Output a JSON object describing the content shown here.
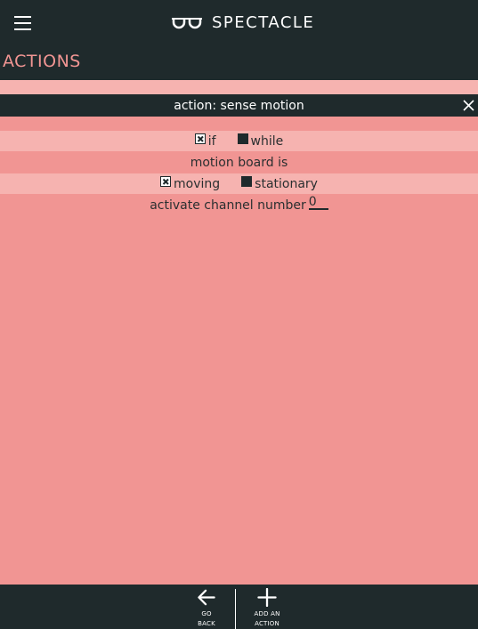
{
  "header": {
    "brand": "SPECTACLE",
    "menu_icon": "hamburger-icon",
    "logo_icon": "glasses-icon"
  },
  "section": {
    "title": "ACTIONS"
  },
  "action": {
    "title": "action: sense motion",
    "close_icon": "close-icon",
    "mode": {
      "if_label": "if",
      "if_checked": true,
      "while_label": "while",
      "while_checked": false
    },
    "motion_label": "motion board is",
    "state": {
      "moving_label": "moving",
      "moving_checked": true,
      "stationary_label": "stationary",
      "stationary_checked": false
    },
    "channel_label": "activate channel number",
    "channel_value": "0"
  },
  "footer": {
    "back_line1": "GO",
    "back_line2": "BACK",
    "back_icon": "arrow-left-icon",
    "add_line1": "ADD AN",
    "add_line2": "ACTION",
    "add_icon": "plus-icon"
  },
  "colors": {
    "dark": "#1f2a2c",
    "accent": "#f19593",
    "accent_light": "#f6b3b0"
  }
}
